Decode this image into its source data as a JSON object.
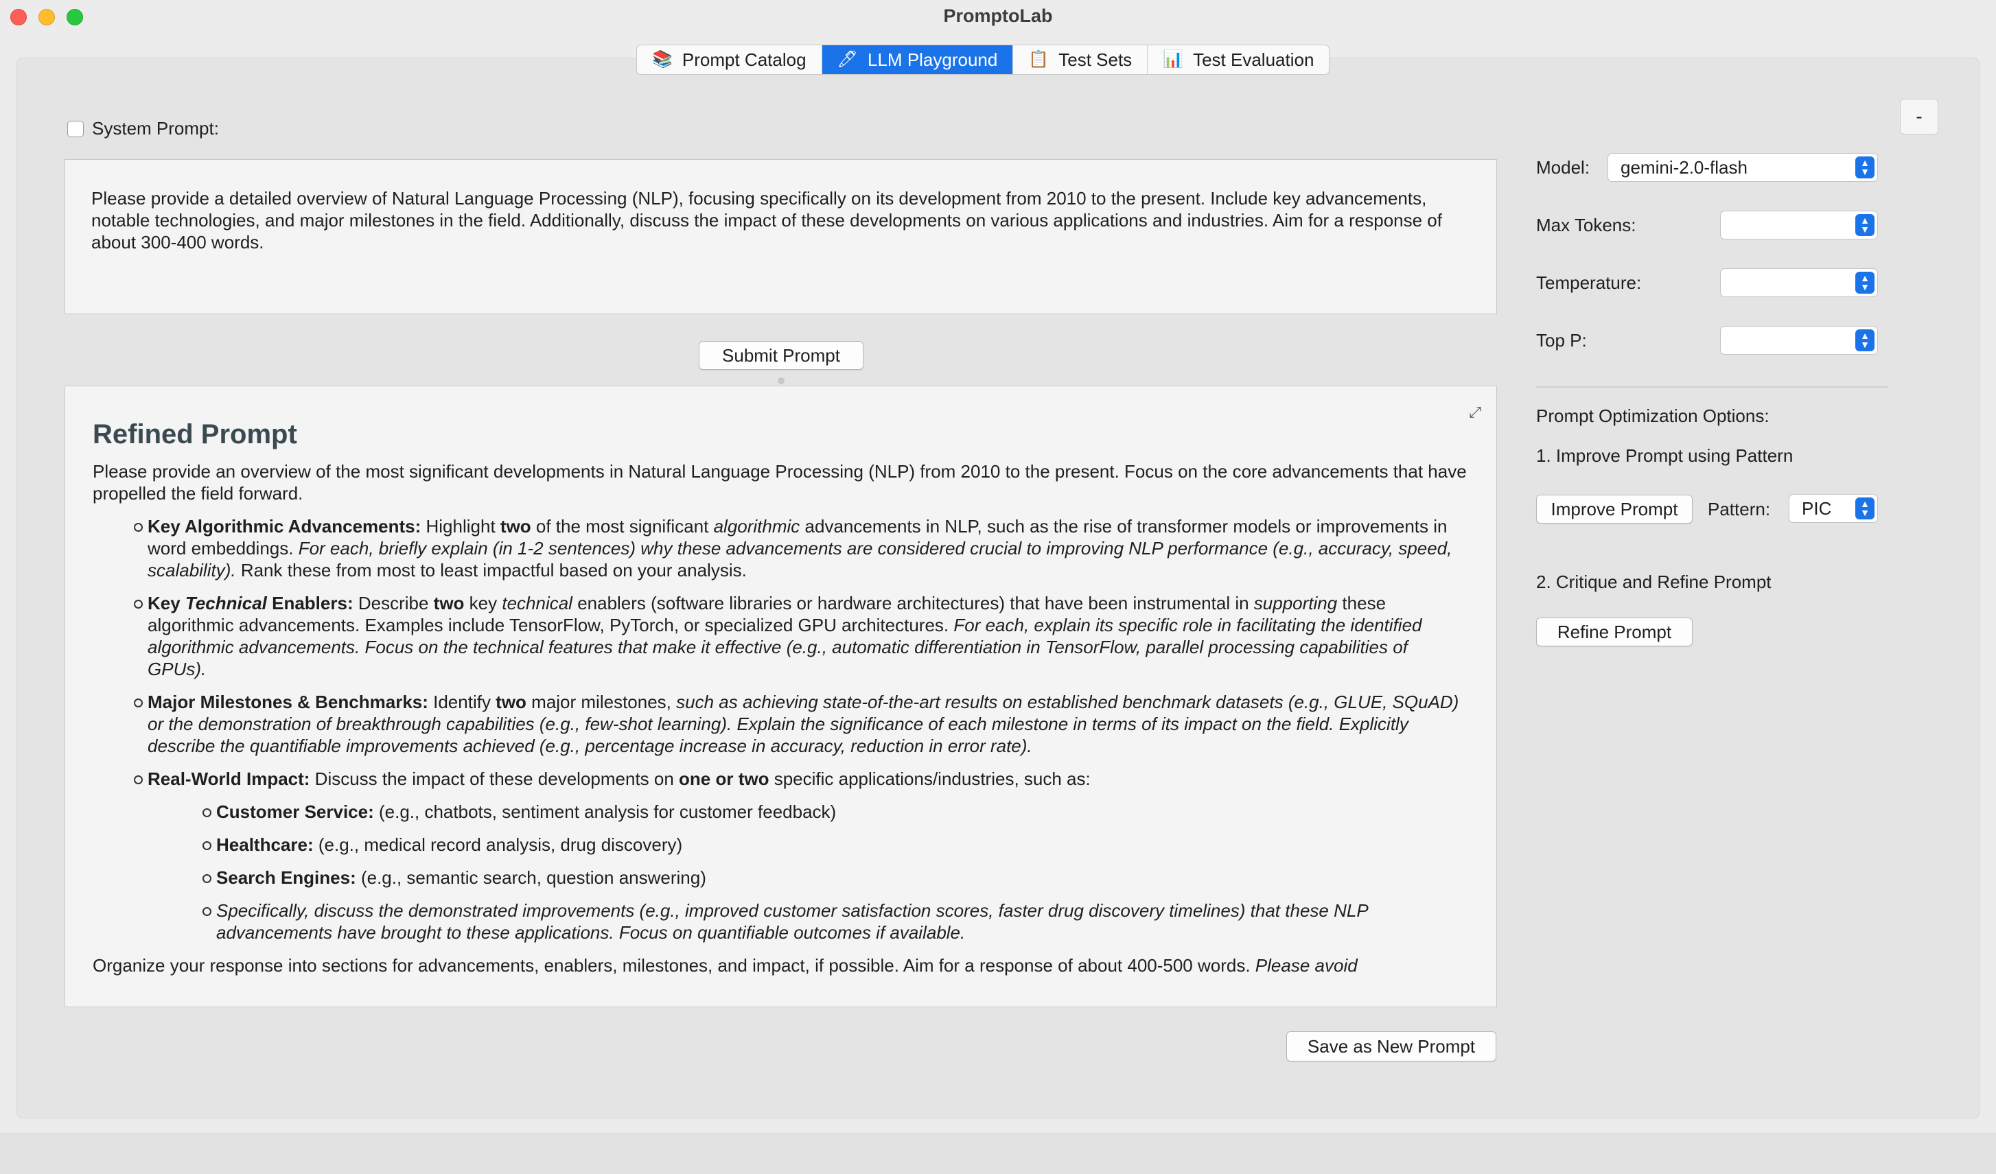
{
  "window": {
    "title": "PromptoLab"
  },
  "tabs": [
    {
      "label": "Prompt Catalog",
      "icon": "books-icon",
      "glyph": "📚",
      "active": false
    },
    {
      "label": "LLM Playground",
      "icon": "pencil-icon",
      "glyph": "🖊",
      "active": true
    },
    {
      "label": "Test Sets",
      "icon": "clipboard-icon",
      "glyph": "📋",
      "active": false
    },
    {
      "label": "Test Evaluation",
      "icon": "bar-chart-icon",
      "glyph": "📊",
      "active": false
    }
  ],
  "playground": {
    "system_prompt_label": "System Prompt:",
    "system_prompt_checked": false,
    "prompt_text": "Please provide a detailed overview of Natural Language Processing (NLP), focusing specifically on its development from 2010 to the present. Include key advancements, notable technologies, and major milestones in the field. Additionally, discuss the impact of these developments on various applications and industries. Aim for a response of about 300-400 words.",
    "submit_label": "Submit Prompt",
    "save_label": "Save as New Prompt",
    "expand_glyph": "⤢",
    "output": {
      "heading": "Refined Prompt",
      "intro": "Please provide an overview of the most significant developments in Natural Language Processing (NLP) from 2010 to the present. Focus on the core advancements that have propelled the field forward.",
      "b1": {
        "title": "Key Algorithmic Advancements:",
        "t1": " Highlight ",
        "bold1": "two",
        "t2": " of the most significant ",
        "it1": "algorithmic",
        "t3": " advancements in NLP, such as the rise of transformer models or improvements in word embeddings. ",
        "it2": "For each, briefly explain (in 1-2 sentences) why these advancements are considered crucial to improving NLP performance (e.g., accuracy, speed, scalability).",
        "t4": " Rank these from most to least impactful based on your analysis."
      },
      "b2": {
        "title_a": "Key ",
        "title_it": "Technical",
        "title_b": " Enablers:",
        "t1": " Describe ",
        "bold1": "two",
        "t2": " key ",
        "it1": "technical",
        "t3": " enablers (software libraries or hardware architectures) that have been instrumental in ",
        "it2": "supporting",
        "t4": " these algorithmic advancements. Examples include TensorFlow, PyTorch, or specialized GPU architectures. ",
        "it3": "For each, explain its specific role in facilitating the identified algorithmic advancements. Focus on the technical features that make it effective (e.g., automatic differentiation in TensorFlow, parallel processing capabilities of GPUs)."
      },
      "b3": {
        "title": "Major Milestones & Benchmarks:",
        "t1": " Identify ",
        "bold1": "two",
        "t2": " major milestones, ",
        "it1": "such as achieving state-of-the-art results on established benchmark datasets (e.g., GLUE, SQuAD) or the demonstration of breakthrough capabilities (e.g., few-shot learning). Explain the significance of each milestone in terms of its impact on the field. Explicitly describe the quantifiable improvements achieved (e.g., percentage increase in accuracy, reduction in error rate)."
      },
      "b4": {
        "title": "Real-World Impact:",
        "t1": " Discuss the impact of these developments on ",
        "bold1": "one or two",
        "t2": " specific applications/industries, such as:",
        "subs": [
          {
            "title": "Customer Service:",
            "text": " (e.g., chatbots, sentiment analysis for customer feedback)"
          },
          {
            "title": "Healthcare:",
            "text": " (e.g., medical record analysis, drug discovery)"
          },
          {
            "title": "Search Engines:",
            "text": " (e.g., semantic search, question answering)"
          }
        ],
        "sub_italic": "Specifically, discuss the demonstrated improvements (e.g., improved customer satisfaction scores, faster drug discovery timelines) that these NLP advancements have brought to these applications. Focus on quantifiable outcomes if available."
      },
      "closing": "Organize your response into sections for advancements, enablers, milestones, and impact, if possible. Aim for a response of about 400-500 words. ",
      "closing_it": "Please avoid"
    }
  },
  "settings": {
    "collapse_label": "-",
    "model_label": "Model:",
    "model_value": "gemini-2.0-flash",
    "max_tokens_label": "Max Tokens:",
    "max_tokens_value": "",
    "temperature_label": "Temperature:",
    "temperature_value": "",
    "top_p_label": "Top P:",
    "top_p_value": "",
    "optimization_title": "Prompt Optimization Options:",
    "option1_label": "1. Improve Prompt using Pattern",
    "improve_button": "Improve Prompt",
    "pattern_label": "Pattern:",
    "pattern_value": "PIC",
    "option2_label": "2. Critique and Refine Prompt",
    "refine_button": "Refine Prompt"
  },
  "colors": {
    "accent": "#1a73e8",
    "window_bg": "#ececec",
    "panel_bg": "#e4e4e4"
  }
}
